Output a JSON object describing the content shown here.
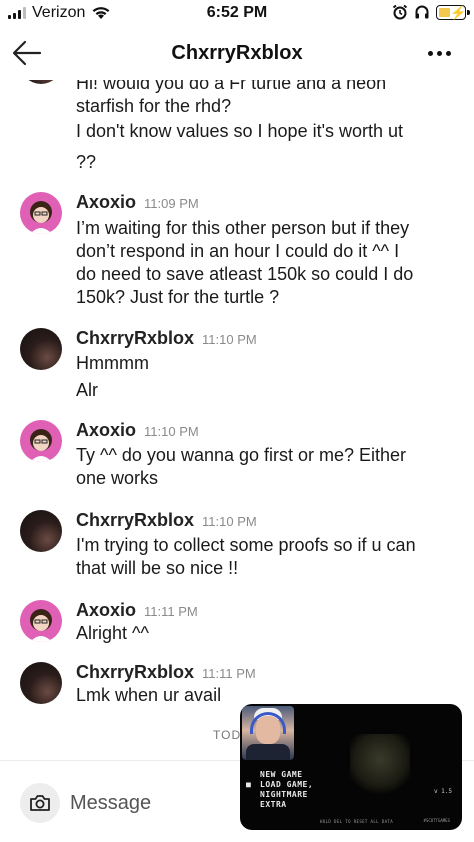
{
  "status_bar": {
    "carrier": "Verizon",
    "time": "6:52 PM",
    "icons": [
      "signal-icon",
      "wifi-icon",
      "alarm-icon",
      "headphones-icon",
      "battery-charging-icon"
    ]
  },
  "header": {
    "title": "ChxrryRxblox",
    "back_icon": "back-arrow-icon",
    "more_icon": "more-dots-icon"
  },
  "messages": [
    {
      "sender": "",
      "timestamp": "",
      "avatar": "dark",
      "lines": [
        "Hi! would you do a Fr turtle and a neon",
        "starfish for the rhd?",
        "I don't know values so I hope it's worth ut",
        "??"
      ]
    },
    {
      "sender": "Axoxio",
      "timestamp": "11:09 PM",
      "avatar": "pink",
      "lines": [
        "I’m waiting for this other person but if they",
        "don’t respond in an hour I could do it ^^ I",
        "do need to save atleast 150k so could I do",
        "150k? Just for the turtle ?"
      ]
    },
    {
      "sender": "ChxrryRxblox",
      "timestamp": "11:10 PM",
      "avatar": "dark",
      "lines": [
        "Hmmmm",
        "Alr"
      ]
    },
    {
      "sender": "Axoxio",
      "timestamp": "11:10 PM",
      "avatar": "pink",
      "lines": [
        "Ty ^^ do you wanna go first or me? Either",
        "one works"
      ]
    },
    {
      "sender": "ChxrryRxblox",
      "timestamp": "11:10 PM",
      "avatar": "dark",
      "lines": [
        "I'm trying to collect some proofs so if u can",
        "that will be so nice !!"
      ]
    },
    {
      "sender": "Axoxio",
      "timestamp": "11:11 PM",
      "avatar": "pink",
      "lines": [
        "Alright ^^"
      ]
    },
    {
      "sender": "ChxrryRxblox",
      "timestamp": "11:11 PM",
      "avatar": "dark",
      "lines": [
        "Lmk when ur avail"
      ]
    }
  ],
  "typing_text": "TOD",
  "composer": {
    "placeholder": "Message",
    "camera_icon": "camera-icon"
  },
  "video_overlay": {
    "menu_items": [
      "NEW GAME",
      "LOAD GAME,",
      "NIGHTMARE",
      "EXTRA"
    ],
    "version": "v 1.5",
    "footer": "HOLD DEL TO RESET ALL DATA",
    "brand": "#SCOTTGAMES"
  }
}
